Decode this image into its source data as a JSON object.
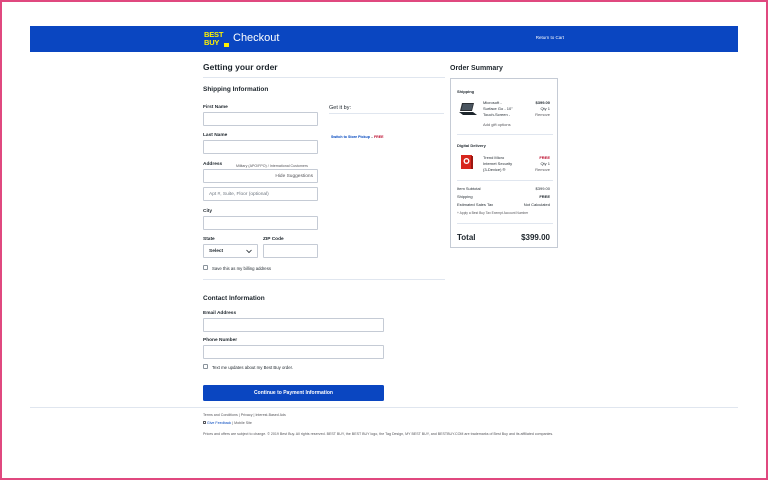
{
  "header": {
    "logo_line1": "BEST",
    "logo_line2": "BUY",
    "title": "Checkout",
    "return_link": "Return to Cart"
  },
  "page_title": "Getting your order",
  "shipping": {
    "heading": "Shipping Information",
    "get_it_by": "Get it by:",
    "switch_pickup": "Switch to Store Pickup",
    "free": "FREE",
    "first_name_label": "First Name",
    "first_name_value": "",
    "last_name_label": "Last Name",
    "last_name_value": "",
    "address_label": "Address",
    "address_hint": "Military (APO/FPO) / International Customers",
    "hide_suggestions": "Hide Suggestions",
    "apt_placeholder": "Apt #, Suite, Floor (optional)",
    "city_label": "City",
    "state_label": "State",
    "state_value": "Select",
    "zip_label": "ZIP Code",
    "billing_checkbox": "Save this as my billing address"
  },
  "contact": {
    "heading": "Contact Information",
    "email_label": "Email Address",
    "phone_label": "Phone Number",
    "text_checkbox": "Text me updates about my Best Buy order."
  },
  "continue_button": "Continue to Payment Information",
  "summary": {
    "title": "Order Summary",
    "shipping_heading": "Shipping",
    "item1_name_1": "Microsoft -",
    "item1_name_2": "Surface Go - 10\"",
    "item1_name_3": "Touch-Screen -",
    "item1_price": "$399.00",
    "item1_qty": "Qty 1",
    "remove": "Remove",
    "add_gift": "Add gift options",
    "digital_heading": "Digital Delivery",
    "item2_name_1": "Trend Micro",
    "item2_name_2": "Internet Security",
    "item2_name_3": "(3-Device) ®",
    "item2_price": "FREE",
    "item2_qty": "Qty 1",
    "subtotal_label": "Item Subtotal",
    "subtotal_value": "$399.00",
    "shipping_label": "Shipping",
    "shipping_value": "FREE",
    "tax_label": "Estimated Sales Tax",
    "tax_value": "Not Calculated",
    "tax_exempt": "+ Apply a Best Buy Tax Exempt Account Number",
    "total_label": "Total",
    "total_value": "$399.00"
  },
  "footer": {
    "terms": "Terms and Conditions",
    "privacy": "Privacy",
    "interest_ads": "Interest-Based Ads",
    "feedback": "Give Feedback",
    "mobile": "Mobile Site",
    "legal": "Prices and offers are subject to change. © 2019 Best Buy. All rights reserved. BEST BUY, the BEST BUY logo, the Tag Design, MY BEST BUY, and BESTBUY.COM are trademarks of Best Buy and its affiliated companies."
  },
  "colors": {
    "brand_blue": "#0a46c1",
    "brand_yellow": "#fff200",
    "free_red": "#bb0628"
  }
}
